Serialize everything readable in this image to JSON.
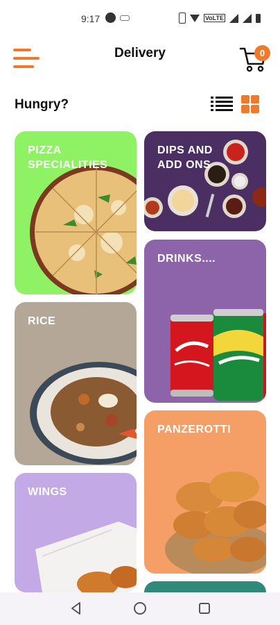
{
  "status_bar": {
    "time": "9:17",
    "network_label": "VoLTE"
  },
  "header": {
    "title": "Delivery",
    "cart_count": "0",
    "accent_color": "#f07a2b"
  },
  "section": {
    "title": "Hungry?"
  },
  "categories": [
    {
      "label": "PIZZA SPECIALITIES",
      "color": "#8ef264"
    },
    {
      "label": "DIPS and ADD ONS",
      "color": "#4b2f63"
    },
    {
      "label": "DRINKS....",
      "color": "#8d63a9"
    },
    {
      "label": "RICE",
      "color": "#b4a798"
    },
    {
      "label": "PANZEROTTI",
      "color": "#f59e66"
    },
    {
      "label": "WINGS",
      "color": "#c3a9e6"
    }
  ],
  "icons": {
    "menu": "menu-icon",
    "cart": "cart-icon",
    "list_view": "list-view-icon",
    "grid_view": "grid-view-icon",
    "back": "back-icon",
    "home": "home-icon",
    "recents": "recents-icon"
  }
}
